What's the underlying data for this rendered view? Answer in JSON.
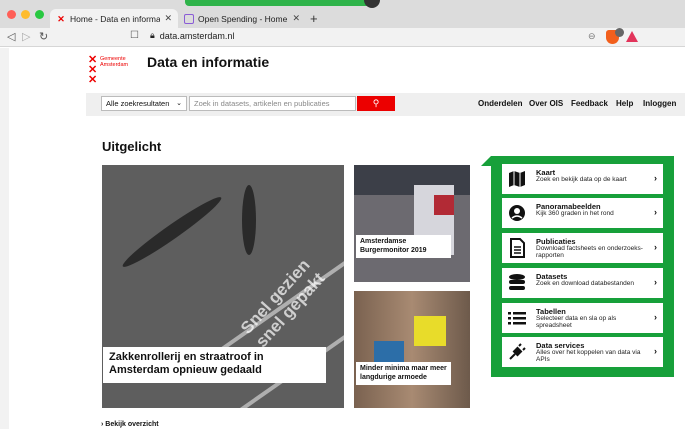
{
  "browser": {
    "tabs": [
      {
        "title": "Home - Data en informatie - Am"
      },
      {
        "title": "Open Spending - Home"
      }
    ],
    "new_tab": "+",
    "address": "data.amsterdam.nl"
  },
  "site": {
    "logo_lines": [
      "Gemeente",
      "Amsterdam"
    ],
    "title": "Data en informatie"
  },
  "search": {
    "select_value": "Alle zoekresultaten",
    "placeholder": "Zoek in datasets, artikelen en publicaties"
  },
  "nav": [
    "Onderdelen",
    "Over OIS",
    "Feedback",
    "Help",
    "Inloggen"
  ],
  "featured": {
    "title": "Uitgelicht",
    "hero_caption": "Zakkenrollerij en straatroof in Amsterdam opnieuw gedaald",
    "hero_ground_text": "Snel gezien snel gepakt",
    "card1_caption": "Amsterdamse Burgermonitor 2019",
    "card2_caption": "Minder minima maar meer langdurige armoede",
    "overview_link": "Bekijk overzicht"
  },
  "tools": [
    {
      "title": "Kaart",
      "desc": "Zoek en bekijk data op de kaart",
      "icon": "map-icon"
    },
    {
      "title": "Panoramabeelden",
      "desc": "Kijk 360 graden in het rond",
      "icon": "panorama-icon"
    },
    {
      "title": "Publicaties",
      "desc": "Download factsheets en onderzoeks-rapporten",
      "icon": "document-icon"
    },
    {
      "title": "Datasets",
      "desc": "Zoek en download databestanden",
      "icon": "database-icon"
    },
    {
      "title": "Tabellen",
      "desc": "Selecteer data en sla op als spreadsheet",
      "icon": "table-list-icon"
    },
    {
      "title": "Data services",
      "desc": "Alles over het koppelen van data via APIs",
      "icon": "plug-icon"
    }
  ],
  "colors": {
    "brand_red": "#ec0000",
    "tools_green": "#17a03a"
  }
}
